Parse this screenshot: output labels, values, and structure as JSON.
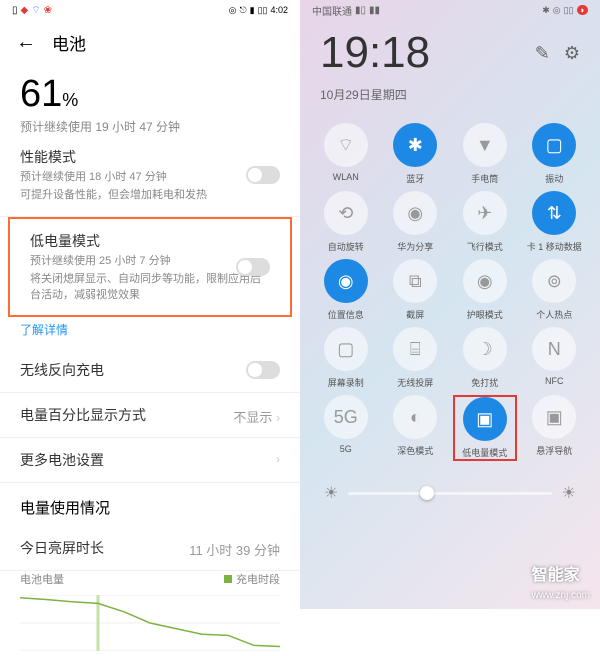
{
  "left": {
    "statusbar": {
      "time": "4:02"
    },
    "title": "电池",
    "percent": "61",
    "percent_unit": "%",
    "estimate": "预计继续使用 19 小时 47 分钟",
    "perf": {
      "title": "性能模式",
      "sub1": "预计继续使用 18 小时 47 分钟",
      "sub2": "可提升设备性能，但会增加耗电和发热"
    },
    "low": {
      "title": "低电量模式",
      "sub1": "预计继续使用 25 小时 7 分钟",
      "sub2": "将关闭熄屏显示、自动同步等功能，限制应用后台活动，减弱视觉效果"
    },
    "learn": "了解详情",
    "reverse": "无线反向充电",
    "pctmode": {
      "title": "电量百分比显示方式",
      "val": "不显示"
    },
    "more": "更多电池设置",
    "usage_title": "电量使用情况",
    "screen": {
      "title": "今日亮屏时长",
      "val": "11 小时 39 分钟"
    },
    "chart": {
      "label1": "电池电量",
      "label2": "充电时段"
    }
  },
  "right": {
    "statusbar": {
      "carrier": "中国联通"
    },
    "time": "19:18",
    "date": "10月29日星期四",
    "tiles": [
      {
        "name": "wlan",
        "label": "WLAN",
        "on": false,
        "icon": "⌔"
      },
      {
        "name": "bluetooth",
        "label": "蓝牙",
        "on": true,
        "icon": "✱"
      },
      {
        "name": "flashlight",
        "label": "手电筒",
        "on": false,
        "icon": "▼"
      },
      {
        "name": "vibrate",
        "label": "振动",
        "on": true,
        "icon": "▢"
      },
      {
        "name": "autorotate",
        "label": "自动旋转",
        "on": false,
        "icon": "⟲"
      },
      {
        "name": "share",
        "label": "华为分享",
        "on": false,
        "icon": "◉"
      },
      {
        "name": "airplane",
        "label": "飞行模式",
        "on": false,
        "icon": "✈"
      },
      {
        "name": "mobiledata",
        "label": "卡 1 移动数据",
        "on": true,
        "icon": "⇅"
      },
      {
        "name": "location",
        "label": "位置信息",
        "on": true,
        "icon": "◉"
      },
      {
        "name": "screenshot",
        "label": "截屏",
        "on": false,
        "icon": "⧉"
      },
      {
        "name": "eyecare",
        "label": "护眼模式",
        "on": false,
        "icon": "◉"
      },
      {
        "name": "hotspot",
        "label": "个人热点",
        "on": false,
        "icon": "⊚"
      },
      {
        "name": "record",
        "label": "屏幕录制",
        "on": false,
        "icon": "▢"
      },
      {
        "name": "cast",
        "label": "无线投屏",
        "on": false,
        "icon": "⌸"
      },
      {
        "name": "dnd",
        "label": "免打扰",
        "on": false,
        "icon": "☽"
      },
      {
        "name": "nfc",
        "label": "NFC",
        "on": false,
        "icon": "N"
      },
      {
        "name": "5g",
        "label": "5G",
        "on": false,
        "icon": "5G"
      },
      {
        "name": "dark",
        "label": "深色模式",
        "on": false,
        "icon": "◐"
      },
      {
        "name": "lowpower",
        "label": "低电量模式",
        "on": true,
        "icon": "▣",
        "highlight": true
      },
      {
        "name": "floatnav",
        "label": "悬浮导航",
        "on": false,
        "icon": "▣"
      }
    ]
  },
  "watermark": {
    "brand": "智能家",
    "url": "www.znj.com"
  },
  "chart_data": {
    "type": "line",
    "title": "电池电量",
    "x": [
      0,
      2,
      4,
      6,
      8,
      10,
      12,
      14,
      16,
      18,
      20
    ],
    "values": [
      95,
      92,
      88,
      85,
      70,
      50,
      40,
      30,
      28,
      10,
      8
    ],
    "ylim": [
      0,
      100
    ],
    "charge_segments": [
      [
        6,
        8
      ]
    ]
  }
}
